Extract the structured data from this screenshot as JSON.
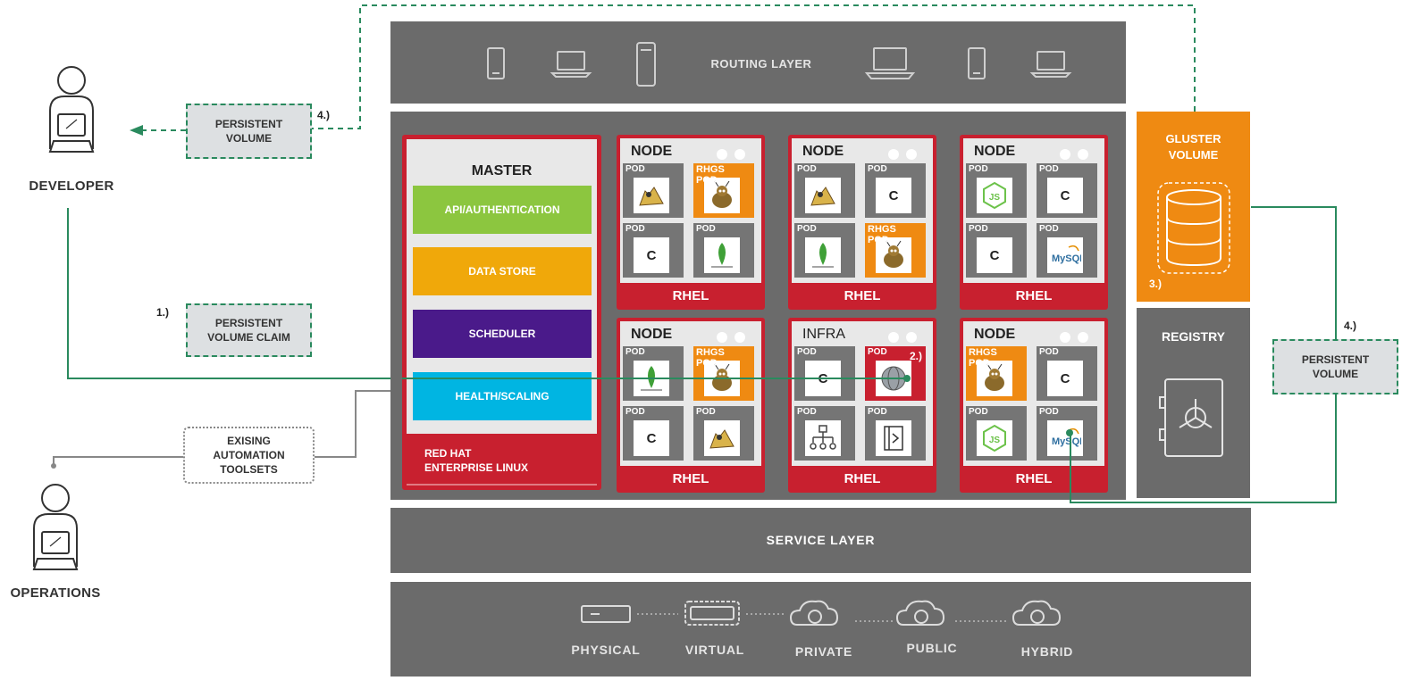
{
  "actors": {
    "developer": {
      "label": "DEVELOPER"
    },
    "operations": {
      "label": "OPERATIONS"
    }
  },
  "callouts": {
    "pv_left": {
      "text": "PERSISTENT\nVOLUME",
      "step": "4.)"
    },
    "pvc": {
      "text": "PERSISTENT\nVOLUME CLAIM",
      "step": "1.)"
    },
    "automation": {
      "text": "EXISING\nAUTOMATION\nTOOLSETS"
    },
    "pv_right": {
      "text": "PERSISTENT\nVOLUME",
      "step": "4.)"
    }
  },
  "routing_layer": {
    "label": "ROUTING LAYER"
  },
  "service_layer": {
    "label": "SERVICE LAYER"
  },
  "master": {
    "title": "MASTER",
    "components": [
      {
        "label": "API/AUTHENTICATION",
        "color": "#8cc63f"
      },
      {
        "label": "DATA STORE",
        "color": "#f0a80a"
      },
      {
        "label": "SCHEDULER",
        "color": "#4a1a8a"
      },
      {
        "label": "HEALTH/SCALING",
        "color": "#00b5e2"
      }
    ],
    "os_label": "RED HAT\nENTERPRISE LINUX"
  },
  "nodes": [
    {
      "title": "NODE",
      "os": "RHEL",
      "pods": [
        {
          "label": "POD",
          "icon": "tomcat-icon"
        },
        {
          "label": "RHGS POD",
          "icon": "gluster-ant-icon"
        },
        {
          "label": "POD",
          "icon": "c-text",
          "text": "C"
        },
        {
          "label": "POD",
          "icon": "mongodb-icon"
        }
      ]
    },
    {
      "title": "NODE",
      "os": "RHEL",
      "pods": [
        {
          "label": "POD",
          "icon": "tomcat-icon"
        },
        {
          "label": "POD",
          "icon": "c-text",
          "text": "C"
        },
        {
          "label": "POD",
          "icon": "mongodb-icon"
        },
        {
          "label": "RHGS POD",
          "icon": "gluster-ant-icon"
        }
      ]
    },
    {
      "title": "NODE",
      "os": "RHEL",
      "pods": [
        {
          "label": "POD",
          "icon": "nodejs-icon"
        },
        {
          "label": "POD",
          "icon": "c-text",
          "text": "C"
        },
        {
          "label": "POD",
          "icon": "c-text",
          "text": "C"
        },
        {
          "label": "POD",
          "icon": "mysql-icon"
        }
      ]
    },
    {
      "title": "NODE",
      "os": "RHEL",
      "pods": [
        {
          "label": "POD",
          "icon": "mongodb-icon"
        },
        {
          "label": "RHGS POD",
          "icon": "gluster-ant-icon"
        },
        {
          "label": "POD",
          "icon": "c-text",
          "text": "C"
        },
        {
          "label": "POD",
          "icon": "tomcat-icon"
        }
      ]
    },
    {
      "title": "INFRA",
      "os": "RHEL",
      "step": "2.)",
      "pods": [
        {
          "label": "POD",
          "icon": "c-text",
          "text": "C"
        },
        {
          "label": "POD",
          "icon": "globe-icon"
        },
        {
          "label": "POD",
          "icon": "org-chart-icon"
        },
        {
          "label": "POD",
          "icon": "document-icon"
        }
      ]
    },
    {
      "title": "NODE",
      "os": "RHEL",
      "pods": [
        {
          "label": "RHGS POD",
          "icon": "gluster-ant-icon"
        },
        {
          "label": "POD",
          "icon": "c-text",
          "text": "C"
        },
        {
          "label": "POD",
          "icon": "nodejs-icon"
        },
        {
          "label": "POD",
          "icon": "mysql-icon"
        }
      ]
    }
  ],
  "gluster": {
    "title": "GLUSTER\nVOLUME",
    "step": "3.)",
    "color": "#ef8a12"
  },
  "registry": {
    "title": "REGISTRY"
  },
  "infrastructure": [
    {
      "label": "PHYSICAL",
      "icon": "server-icon"
    },
    {
      "label": "VIRTUAL",
      "icon": "virtual-server-icon"
    },
    {
      "label": "PRIVATE",
      "icon": "private-cloud-icon"
    },
    {
      "label": "PUBLIC",
      "icon": "public-cloud-icon"
    },
    {
      "label": "HYBRID",
      "icon": "hybrid-cloud-icon"
    }
  ],
  "colors": {
    "red": "#c8202f",
    "connector_green": "#2a8a5e",
    "layer_gray": "#6b6b6b"
  }
}
